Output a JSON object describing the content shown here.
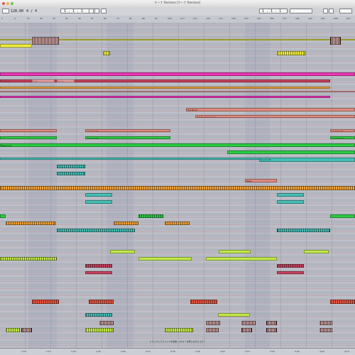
{
  "window": {
    "title": "ケーナ Remixes [ケーナ Remixes]"
  },
  "transport": {
    "bpm": "128.00",
    "signature": "4 / 4",
    "position": "1 . 1 . 1",
    "loop_start": "1 . 1 . 1"
  },
  "clip_names": {
    "a": "Audio 1",
    "b": "Kick",
    "c": "Snare",
    "d": "Bass",
    "e": "Lead Synth",
    "f": "Lead Synth",
    "g": "Lead Synth",
    "h": "Vox Build",
    "i": "Vox Build Reverse",
    "j": "Bass Line",
    "k": "Drums Fill",
    "l": "Riser",
    "m": "Lead Synth"
  },
  "status": {
    "text": "ドラッグしてクリップを移動、Altキーを押しながらコピー"
  },
  "bottom_ruler": [
    "1:00",
    "1:15",
    "1:30",
    "1:45",
    "2:00",
    "2:15",
    "2:30",
    "2:45",
    "3:00",
    "3:15",
    "3:30",
    "3:45",
    "4:00",
    "4:15"
  ],
  "ruler_bars": [
    "1",
    "9",
    "17",
    "25",
    "33",
    "41",
    "49",
    "57",
    "65",
    "73",
    "81",
    "89",
    "97",
    "105",
    "113",
    "121",
    "129",
    "137",
    "145",
    "153",
    "161",
    "169",
    "177",
    "185",
    "193",
    "201",
    "209",
    "217"
  ],
  "colors": {
    "yellow": "#f0ee3a",
    "magenta": "#ea37b5",
    "salmon": "#e08a7e",
    "green": "#2ccb43",
    "teal": "#46bfb7",
    "orange": "#f0a23a",
    "lime": "#c2e84a",
    "red": "#e5533d",
    "pink": "#f0a6a6",
    "crimson": "#c8425e"
  }
}
